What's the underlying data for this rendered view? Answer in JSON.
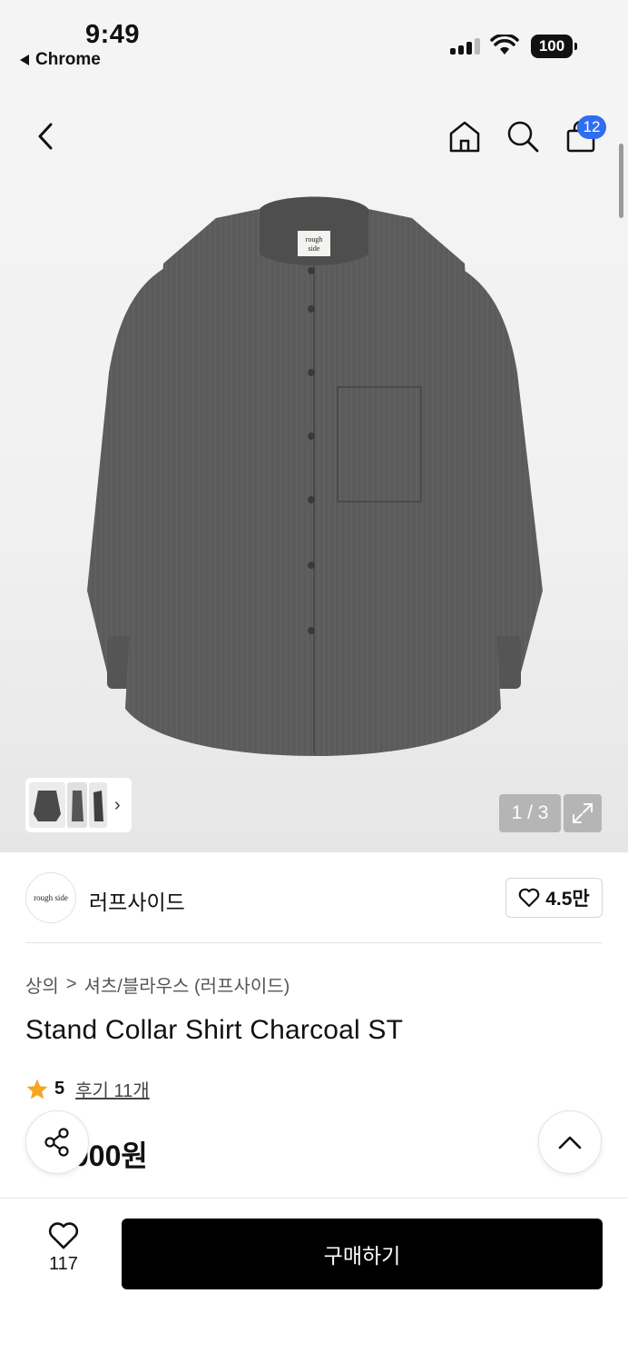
{
  "status_bar": {
    "time": "9:49",
    "back_app": "Chrome",
    "battery": "100"
  },
  "header": {
    "cart_count": "12"
  },
  "gallery": {
    "pager": "1 / 3",
    "shirt_label_line1": "rough",
    "shirt_label_line2": "side"
  },
  "brand": {
    "logo_text": "rough side",
    "name": "러프사이드",
    "likes": "4.5만"
  },
  "breadcrumb": {
    "level1": "상의",
    "separator": ">",
    "level2": "셔츠/블라우스 (러프사이드)"
  },
  "product": {
    "title": "Stand Collar Shirt Charcoal ST",
    "rating": "5",
    "reviews": "후기 11개",
    "price": "000원"
  },
  "bottom": {
    "wish_count": "117",
    "buy_label": "구매하기"
  },
  "colors": {
    "accent_blue": "#2f6ef0",
    "star": "#f5a623",
    "shirt": "#5b5b5b"
  }
}
